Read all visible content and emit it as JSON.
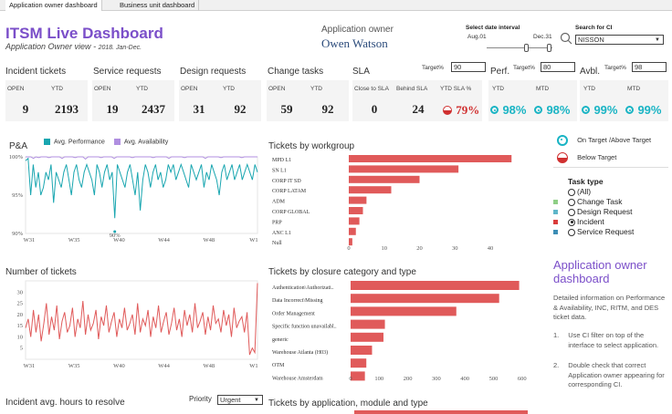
{
  "tabs": [
    {
      "label": "Application owner dashboard",
      "active": true
    },
    {
      "label": "Business unit dashboard",
      "active": false
    }
  ],
  "header": {
    "title": "ITSM Live Dashboard",
    "subtitle": "Application Owner view",
    "subtitle_sep": "-",
    "period": "2018. Jan-Dec.",
    "owner_label": "Application owner",
    "owner_name": "Owen Watson"
  },
  "date_filter": {
    "label": "Select date interval",
    "start": "Aug.01",
    "end": "Dec.31",
    "start_frac": 0.6,
    "end_frac": 0.95
  },
  "ci_search": {
    "label": "Search for CI",
    "value": "NISSON"
  },
  "sections": {
    "incident": "Incident tickets",
    "service": "Service requests",
    "design": "Design requests",
    "change": "Change tasks",
    "sla": "SLA",
    "perf": "Perf.",
    "avbl": "Avbl."
  },
  "targets": {
    "label": "Target%",
    "sla": "90",
    "perf": "80",
    "avbl": "98"
  },
  "kpis": {
    "incident": {
      "h1": "OPEN",
      "h2": "YTD",
      "v1": "9",
      "v2": "2193"
    },
    "service": {
      "h1": "OPEN",
      "h2": "YTD",
      "v1": "19",
      "v2": "2437"
    },
    "design": {
      "h1": "OPEN",
      "h2": "YTD",
      "v1": "31",
      "v2": "92"
    },
    "change": {
      "h1": "OPEN",
      "h2": "YTD",
      "v1": "59",
      "v2": "92"
    },
    "sla": {
      "h1": "Close to SLA",
      "h2": "Behind SLA",
      "h3": "YTD SLA %",
      "v1": "0",
      "v2": "24",
      "v3": "79%"
    },
    "perf": {
      "h1": "YTD",
      "h2": "MTD",
      "v1": "98%",
      "v2": "98%"
    },
    "avbl": {
      "h1": "YTD",
      "h2": "MTD",
      "v1": "99%",
      "v2": "99%"
    }
  },
  "legend_status": {
    "on_target": "On Target /Above Target",
    "below": "Below Target"
  },
  "task_type": {
    "title": "Task type",
    "options": [
      "(All)",
      "Change Task",
      "Design Request",
      "Incident",
      "Service Request"
    ],
    "selected": "Incident",
    "colors": [
      "",
      "#8fcf86",
      "#5fb6c9",
      "#d93c3c",
      "#3c8db5"
    ]
  },
  "info": {
    "title": "Application owner dashboard",
    "desc": "Detailed information on Performance & Availability, INC, RITM, and DES ticket data.",
    "steps": [
      {
        "num": "1.",
        "text": "Use CI filter on top of the interface to select application."
      },
      {
        "num": "2.",
        "text": "Double check that correct Application owner appearing for corresponding CI."
      }
    ]
  },
  "incident_hours": {
    "title": "Incident avg. hours to resolve",
    "priority_label": "Priority",
    "priority_value": "Urgent"
  },
  "colors": {
    "accent": "#7b4fc9",
    "teal": "#19b4c4",
    "red": "#e05a5a",
    "purple": "#b08fe0"
  },
  "chart_data": [
    {
      "type": "line",
      "title": "P&A",
      "series": [
        {
          "name": "Avg. Performance",
          "color": "#19a6b0",
          "values": [
            99.5,
            99.8,
            95,
            99,
            96,
            98,
            95,
            96,
            98,
            97,
            99,
            94,
            98,
            97,
            96,
            98,
            99,
            97,
            95,
            98,
            99,
            97,
            96,
            98,
            99,
            98,
            97,
            95,
            99,
            98,
            96,
            98,
            99,
            97,
            98,
            92,
            99,
            98,
            97,
            96,
            98,
            99,
            97,
            95,
            98,
            93,
            97,
            99,
            98,
            96,
            98,
            99,
            97,
            98,
            96,
            97,
            99,
            98,
            99,
            97,
            98,
            99,
            98,
            97,
            96,
            99,
            98,
            97,
            98,
            99,
            96,
            98,
            97,
            99,
            98,
            97,
            95,
            98,
            99,
            97,
            98,
            99,
            97,
            98,
            99,
            97,
            98,
            99,
            98,
            97,
            99,
            98
          ]
        },
        {
          "name": "Avg. Availability",
          "color": "#b08fe0",
          "values": [
            100,
            100,
            100,
            99.8,
            100,
            99.9,
            100,
            100,
            100,
            99.9,
            100,
            100,
            100,
            100,
            99.8,
            100,
            100,
            100,
            100,
            99.9,
            100,
            100,
            100,
            99.7,
            100,
            100,
            100,
            100,
            100,
            99.9,
            100,
            100,
            100,
            100,
            99.8,
            100,
            100,
            100,
            100,
            100,
            100,
            99.9,
            100,
            100,
            100,
            100,
            100,
            100,
            100,
            99.9,
            100,
            100,
            100,
            100,
            100,
            99.8,
            100,
            100,
            100,
            100,
            100,
            99.9,
            100,
            100,
            100,
            100,
            100,
            100,
            100,
            99.8,
            100,
            100,
            100,
            100,
            100,
            99.9,
            100,
            100,
            100,
            100,
            100,
            100,
            100,
            99.9,
            100,
            100,
            100,
            100,
            100,
            100
          ]
        }
      ],
      "yticks": [
        "100%",
        "95%",
        "90%"
      ],
      "ylim": [
        90,
        100
      ],
      "xticks": [
        "W31",
        "W35",
        "W40",
        "W44",
        "W48",
        "W1"
      ],
      "annotation": "90%"
    },
    {
      "type": "bar",
      "title": "Tickets by workgroup",
      "categories": [
        "MPD L1",
        "SN L1",
        "CORP IT SD",
        "CORP LATAM",
        "ADM",
        "CORP GLOBAL",
        "PRP",
        "ANC L1",
        "Null"
      ],
      "values": [
        46,
        31,
        20,
        12,
        5,
        4,
        3,
        2,
        1
      ],
      "xticks": [
        "0",
        "10",
        "20",
        "30",
        "40"
      ],
      "xlim": [
        0,
        48
      ]
    },
    {
      "type": "line",
      "title": "Number of tickets",
      "values": [
        14,
        18,
        10,
        22,
        12,
        20,
        8,
        16,
        25,
        11,
        19,
        13,
        24,
        9,
        17,
        21,
        12,
        15,
        23,
        10,
        18,
        14,
        26,
        11,
        20,
        13,
        16,
        22,
        9,
        19,
        15,
        24,
        12,
        17,
        21,
        10,
        18,
        14,
        23,
        13,
        16,
        20,
        11,
        25,
        12,
        18,
        15,
        22,
        10,
        19,
        14,
        24,
        12,
        17,
        21,
        11,
        16,
        23,
        13,
        18,
        10,
        22,
        15,
        20,
        12,
        25,
        14,
        17,
        21,
        11,
        19,
        13,
        24,
        16,
        18,
        12,
        22,
        15,
        20,
        10,
        23,
        14,
        17,
        19,
        12,
        21,
        2,
        5,
        3,
        34
      ],
      "color": "#e05a5a",
      "yticks": [
        "30",
        "25",
        "20",
        "15",
        "10",
        "5"
      ],
      "ylim": [
        0,
        35
      ],
      "xticks": [
        "W31",
        "W35",
        "W40",
        "W44",
        "W48",
        "W1"
      ]
    },
    {
      "type": "bar",
      "title": "Tickets by closure category and type",
      "categories": [
        "Authentication\\Authorizati..",
        "Data Incorrect\\Missing",
        "Order Management",
        "Specific function unavailabl..",
        "generic",
        "Warehouse Atlanta (H03)",
        "OTM",
        "Warehouse Amsterdam"
      ],
      "values": [
        590,
        520,
        370,
        120,
        115,
        75,
        55,
        50
      ],
      "xticks": [
        "0",
        "100",
        "200",
        "300",
        "400",
        "500",
        "600"
      ],
      "xlim": [
        0,
        620
      ]
    }
  ],
  "bottom_chart_title": "Tickets by application, module and type"
}
